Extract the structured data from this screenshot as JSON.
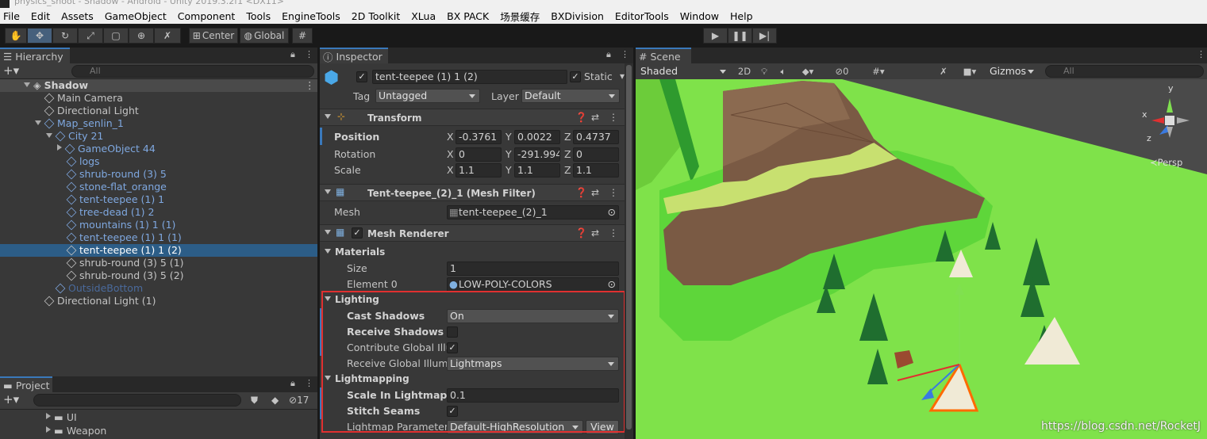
{
  "window": {
    "title": "physics_shoot - Shadow - Android - Unity 2019.3.2f1 <DX11>"
  },
  "menu": [
    "File",
    "Edit",
    "Assets",
    "GameObject",
    "Component",
    "Tools",
    "EngineTools",
    "2D Toolkit",
    "XLua",
    "BX PACK",
    "场景缓存",
    "BXDivision",
    "EditorTools",
    "Window",
    "Help"
  ],
  "toolbar": {
    "pivot_label": "Center",
    "space_label": "Global"
  },
  "hierarchy": {
    "tab": "Hierarchy",
    "search_placeholder": "All",
    "scene": "Shadow",
    "items": [
      {
        "label": "Main Camera",
        "depth": 1,
        "color": "#c4c4c4",
        "arrow": ""
      },
      {
        "label": "Directional Light",
        "depth": 1,
        "color": "#c4c4c4",
        "arrow": ""
      },
      {
        "label": "Map_senlin_1",
        "depth": 1,
        "color": "#7fa8e0",
        "arrow": "down"
      },
      {
        "label": "City 21",
        "depth": 2,
        "color": "#7fa8e0",
        "arrow": "down"
      },
      {
        "label": "GameObject 44",
        "depth": 3,
        "color": "#7fa8e0",
        "arrow": "right"
      },
      {
        "label": "logs",
        "depth": 3,
        "color": "#7fa8e0",
        "arrow": ""
      },
      {
        "label": "shrub-round (3) 5",
        "depth": 3,
        "color": "#7fa8e0",
        "arrow": ""
      },
      {
        "label": "stone-flat_orange",
        "depth": 3,
        "color": "#7fa8e0",
        "arrow": ""
      },
      {
        "label": "tent-teepee (1) 1",
        "depth": 3,
        "color": "#7fa8e0",
        "arrow": ""
      },
      {
        "label": "tree-dead (1) 2",
        "depth": 3,
        "color": "#7fa8e0",
        "arrow": ""
      },
      {
        "label": "mountains (1) 1 (1)",
        "depth": 3,
        "color": "#7fa8e0",
        "arrow": ""
      },
      {
        "label": "tent-teepee (1) 1 (1)",
        "depth": 3,
        "color": "#7fa8e0",
        "arrow": ""
      },
      {
        "label": "tent-teepee (1) 1 (2)",
        "depth": 3,
        "color": "#ffffff",
        "arrow": "",
        "selected": true
      },
      {
        "label": "shrub-round (3) 5 (1)",
        "depth": 3,
        "color": "#c4c4c4",
        "arrow": ""
      },
      {
        "label": "shrub-round (3) 5 (2)",
        "depth": 3,
        "color": "#c4c4c4",
        "arrow": ""
      },
      {
        "label": "OutsideBottom",
        "depth": 2,
        "color": "#4a6a9c",
        "arrow": ""
      },
      {
        "label": "Directional Light (1)",
        "depth": 1,
        "color": "#c4c4c4",
        "arrow": ""
      }
    ]
  },
  "project": {
    "tab": "Project",
    "hidden_count": "17",
    "folders": [
      "UI",
      "Weapon"
    ]
  },
  "inspector": {
    "tab": "Inspector",
    "object_name": "tent-teepee (1) 1 (2)",
    "static_label": "Static",
    "tag_label": "Tag",
    "tag_value": "Untagged",
    "layer_label": "Layer",
    "layer_value": "Default",
    "transform": {
      "title": "Transform",
      "position_label": "Position",
      "rotation_label": "Rotation",
      "scale_label": "Scale",
      "position": {
        "x": "-0.3761",
        "y": "0.0022",
        "z": "0.4737"
      },
      "rotation": {
        "x": "0",
        "y": "-291.994",
        "z": "0"
      },
      "scale": {
        "x": "1.1",
        "y": "1.1",
        "z": "1.1"
      }
    },
    "mesh_filter": {
      "title": "Tent-teepee_(2)_1 (Mesh Filter)",
      "mesh_label": "Mesh",
      "mesh_value": "tent-teepee_(2)_1"
    },
    "mesh_renderer": {
      "title": "Mesh Renderer",
      "materials_label": "Materials",
      "size_label": "Size",
      "size_value": "1",
      "element0_label": "Element 0",
      "element0_value": "LOW-POLY-COLORS",
      "lighting_label": "Lighting",
      "cast_shadows_label": "Cast Shadows",
      "cast_shadows_value": "On",
      "receive_shadows_label": "Receive Shadows",
      "contribute_gi_label": "Contribute Global Illun",
      "receive_gi_label": "Receive Global Illumin",
      "receive_gi_value": "Lightmaps",
      "lightmapping_label": "Lightmapping",
      "scale_lightmap_label": "Scale In Lightmap",
      "scale_lightmap_value": "0.1",
      "stitch_seams_label": "Stitch Seams",
      "lightmap_params_label": "Lightmap Parameters",
      "lightmap_params_value": "Default-HighResolution",
      "view_button": "View"
    }
  },
  "scene": {
    "tab": "Scene",
    "shading": "Shaded",
    "mode_2d": "2D",
    "hidden_count": "0",
    "gizmos": "Gizmos",
    "search_placeholder": "All",
    "persp": "Persp",
    "axis_y": "y",
    "axis_x": "x",
    "axis_z": "z",
    "watermark": "https://blog.csdn.net/RocketJ"
  },
  "colors": {
    "highlight": "#e03030",
    "selection": "#2c5d87",
    "grass": "#7fe24a"
  }
}
